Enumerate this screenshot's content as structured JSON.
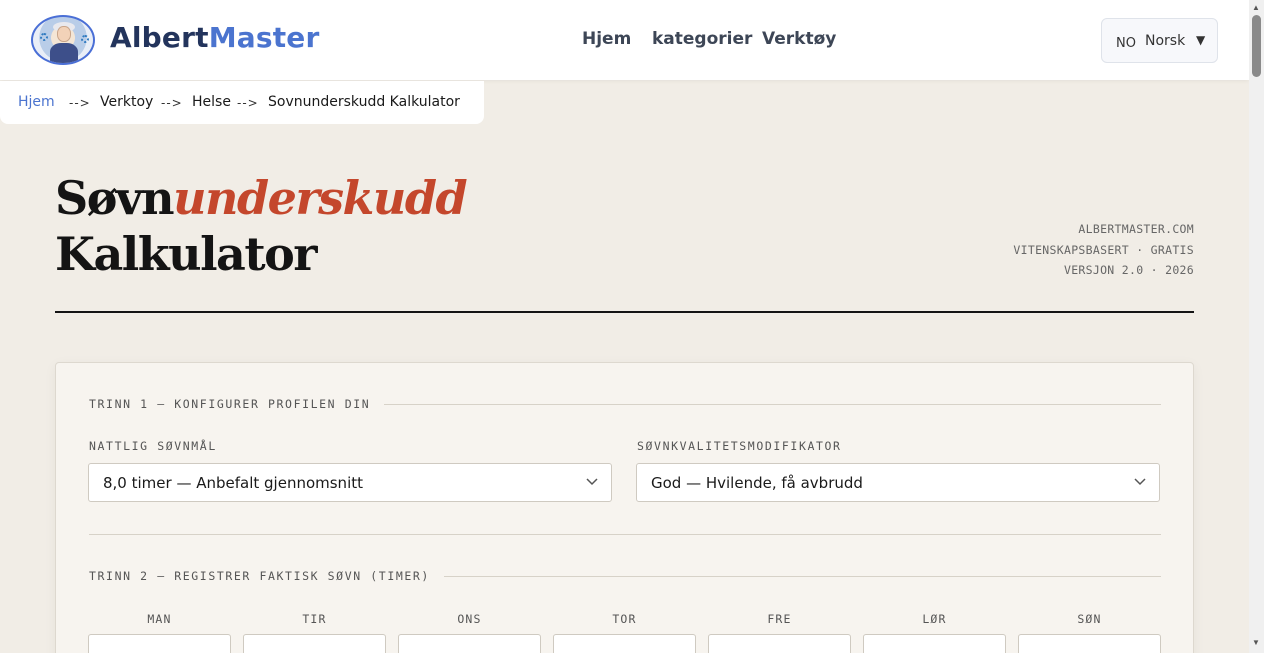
{
  "header": {
    "brand_part1": "Albert",
    "brand_part2": "Master",
    "nav": [
      "Hjem",
      "kategorier",
      "Verktøy"
    ],
    "language": {
      "code": "NO",
      "name": "Norsk",
      "caret": "▼"
    }
  },
  "breadcrumb": [
    {
      "label": "Hjem",
      "link": true
    },
    {
      "label": "Verktoy",
      "link": false
    },
    {
      "label": "Helse",
      "link": false
    },
    {
      "label": "Sovnunderskudd Kalkulator",
      "link": false
    }
  ],
  "breadcrumb_separator": "-->",
  "title": {
    "part1": "Søvn",
    "accent": "underskudd",
    "line2": "Kalkulator"
  },
  "meta": [
    "ALBERTMASTER.COM",
    "VITENSKAPSBASERT · GRATIS",
    "VERSJON 2.0 · 2026"
  ],
  "step1": {
    "label": "TRINN 1 — KONFIGURER PROFILEN DIN",
    "goal_label": "NATTLIG SØVNMÅL",
    "goal_value": "8,0 timer — Anbefalt gjennomsnitt",
    "quality_label": "SØVNKVALITETSMODIFIKATOR",
    "quality_value": "God — Hvilende, få avbrudd"
  },
  "step2": {
    "label": "TRINN 2 — REGISTRER FAKTISK SØVN (TIMER)",
    "days": [
      "MAN",
      "TIR",
      "ONS",
      "TOR",
      "FRE",
      "LØR",
      "SØN"
    ]
  },
  "colors": {
    "accent": "#c4472c",
    "brand_blue": "#4b74cf",
    "brand_dark": "#23345c",
    "background": "#f1ede6"
  }
}
